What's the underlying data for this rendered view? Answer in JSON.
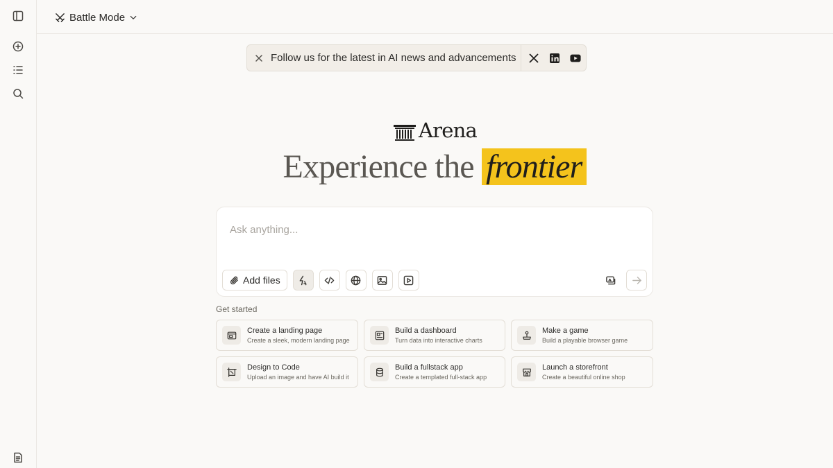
{
  "header": {
    "mode_label": "Battle Mode"
  },
  "banner": {
    "text": "Follow us for the latest in AI news and advancements",
    "social": [
      "x-icon",
      "linkedin-icon",
      "youtube-icon"
    ]
  },
  "brand": {
    "logo_text": "Arena",
    "headline_prefix": "Experience the",
    "headline_highlight": "frontier",
    "highlight_color": "#f4c31c"
  },
  "composer": {
    "placeholder": "Ask anything...",
    "add_files_label": "Add files"
  },
  "get_started": {
    "label": "Get started",
    "cards": [
      {
        "title": "Create a landing page",
        "subtitle": "Create a sleek, modern landing page",
        "icon": "browser-icon"
      },
      {
        "title": "Build a dashboard",
        "subtitle": "Turn data into interactive charts",
        "icon": "dashboard-icon"
      },
      {
        "title": "Make a game",
        "subtitle": "Build a playable browser game",
        "icon": "joystick-icon"
      },
      {
        "title": "Design to Code",
        "subtitle": "Upload an image and have AI build it",
        "icon": "frame-icon"
      },
      {
        "title": "Build a fullstack app",
        "subtitle": "Create a templated full-stack app",
        "icon": "database-icon"
      },
      {
        "title": "Launch a storefront",
        "subtitle": "Create a beautiful online shop",
        "icon": "store-icon"
      }
    ]
  }
}
